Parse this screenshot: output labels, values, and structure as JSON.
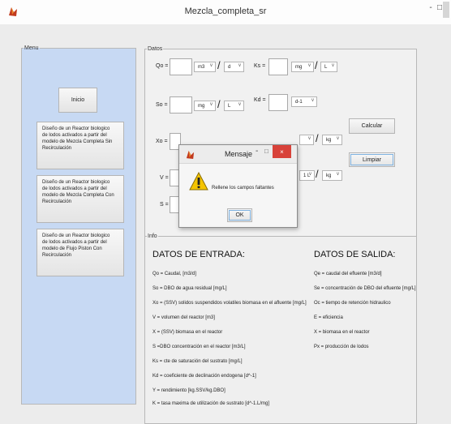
{
  "window": {
    "title": "Mezcla_completa_sr",
    "minimize_glyph": "-",
    "maximize_glyph": "□",
    "app_icon": "matlab-icon"
  },
  "menu": {
    "legend": "Menu",
    "inicio_label": "Inicio",
    "items": [
      {
        "lines": [
          "Diseño de un Reactor biologico",
          "de lodos activados a partir del",
          "modelo de Mezcla Completa Sin",
          "Recirculación"
        ]
      },
      {
        "lines": [
          "Diseño de un Reactor biologico",
          "de lodos activados a partir del",
          "modelo de Mezcla Completa Con",
          "Recirculación"
        ]
      },
      {
        "lines": [
          "Diseño de un Reactor biologico",
          "de lodos activados a partir del",
          "modelo de Flujo Piston Con",
          "Recirculación"
        ]
      }
    ]
  },
  "datos": {
    "legend": "Datos",
    "qo": {
      "label": "Qo =",
      "unit1": "m3",
      "slash": "/",
      "unit2": "d"
    },
    "ks": {
      "label": "Ks =",
      "unit1": "mg",
      "slash": "/",
      "unit2": "L"
    },
    "so": {
      "label": "So =",
      "unit1": "mg",
      "slash": "/",
      "unit2": "L"
    },
    "kd": {
      "label": "Kd =",
      "unit1": "d-1"
    },
    "xo": {
      "label": "Xo ="
    },
    "y": {
      "slash": "/",
      "unit2": "kg"
    },
    "v": {
      "label": "V ="
    },
    "k": {
      "unit1": "1 L",
      "slash": "/",
      "unit2": "kg"
    },
    "s": {
      "label": "S ="
    },
    "calcular_label": "Calcular",
    "limpiar_label": "Limpiar"
  },
  "info": {
    "legend": "Info",
    "entrada_title": "DATOS DE ENTRADA:",
    "entrada_lines": [
      "Qo = Caudal, [m3/d]",
      "So = DBO de agua residual [mg/L]",
      "Xo = (SSV) solidos suspendidos volatiles biomasa en el afluente [mg/L]",
      "V = volumen del reactor [m3]",
      "X = (SSV) biomasa en el reactor",
      "S =DBO concentración en el reactor [m3/L]",
      "Ks = cte de saturación del sustrato [mg/L]",
      "Kd = coeficiente de declinación endogena [d^-1]",
      "Y = rendimiento [kg.SSV/kg.DBO]",
      "K = tasa maxima de utilización de sustrato [d^-1.L/mg]"
    ],
    "salida_title": "DATOS DE SALIDA:",
    "salida_lines": [
      "Qe = caudal del efluente [m3/d]",
      "Se = concentración de DBO del efluente [mg/L]",
      "Oc = tiempo de retención hidraulico",
      "E = eficiencia",
      "X = biomasa en el reactor",
      "Px = producción de lodos"
    ]
  },
  "dialog": {
    "title": "Mensaje",
    "min_glyph": "-",
    "max_glyph": "□",
    "close_glyph": "×",
    "message": "Rellene los campos faltantes",
    "ok_label": "OK",
    "warning_icon": "warning-icon"
  },
  "colors": {
    "menu_panel": "#c7d9f3",
    "close_button": "#d8423a",
    "warning_yellow": "#f5c400"
  }
}
